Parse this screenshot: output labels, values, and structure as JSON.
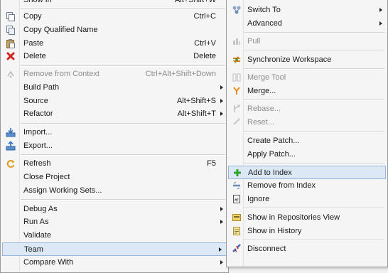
{
  "left_menu": {
    "items": [
      {
        "label": "Show In",
        "shortcut": "Alt+Shift+W",
        "icon": "show-in-icon"
      },
      {
        "label": "Copy",
        "shortcut": "Ctrl+C",
        "icon": "copy-icon"
      },
      {
        "label": "Copy Qualified Name",
        "shortcut": "",
        "icon": "copy-qualified-name-icon"
      },
      {
        "label": "Paste",
        "shortcut": "Ctrl+V",
        "icon": "paste-icon"
      },
      {
        "label": "Delete",
        "shortcut": "Delete",
        "icon": "delete-icon"
      },
      {
        "label": "Remove from Context",
        "shortcut": "Ctrl+Alt+Shift+Down",
        "icon": "remove-from-context-icon"
      },
      {
        "label": "Build Path",
        "shortcut": "",
        "icon": ""
      },
      {
        "label": "Source",
        "shortcut": "Alt+Shift+S",
        "icon": ""
      },
      {
        "label": "Refactor",
        "shortcut": "Alt+Shift+T",
        "icon": ""
      },
      {
        "label": "Import...",
        "shortcut": "",
        "icon": "import-icon"
      },
      {
        "label": "Export...",
        "shortcut": "",
        "icon": "export-icon"
      },
      {
        "label": "Refresh",
        "shortcut": "F5",
        "icon": "refresh-icon"
      },
      {
        "label": "Close Project",
        "shortcut": "",
        "icon": ""
      },
      {
        "label": "Assign Working Sets...",
        "shortcut": "",
        "icon": ""
      },
      {
        "label": "Debug As",
        "shortcut": "",
        "icon": ""
      },
      {
        "label": "Run As",
        "shortcut": "",
        "icon": ""
      },
      {
        "label": "Validate",
        "shortcut": "",
        "icon": ""
      },
      {
        "label": "Team",
        "shortcut": "",
        "icon": ""
      },
      {
        "label": "Compare With",
        "shortcut": "",
        "icon": ""
      }
    ]
  },
  "right_menu": {
    "items": [
      {
        "label": "Switch To",
        "icon": "switch-to-icon"
      },
      {
        "label": "Advanced",
        "icon": ""
      },
      {
        "label": "Pull",
        "icon": "pull-icon"
      },
      {
        "label": "Synchronize Workspace",
        "icon": "synchronize-workspace-icon"
      },
      {
        "label": "Merge Tool",
        "icon": "merge-tool-icon"
      },
      {
        "label": "Merge...",
        "icon": "merge-icon"
      },
      {
        "label": "Rebase...",
        "icon": "rebase-icon"
      },
      {
        "label": "Reset...",
        "icon": "reset-icon"
      },
      {
        "label": "Create Patch...",
        "icon": ""
      },
      {
        "label": "Apply Patch...",
        "icon": ""
      },
      {
        "label": "Add to Index",
        "icon": "add-to-index-icon"
      },
      {
        "label": "Remove from Index",
        "icon": "remove-from-index-icon"
      },
      {
        "label": "Ignore",
        "icon": "ignore-icon"
      },
      {
        "label": "Show in Repositories View",
        "icon": "show-in-repositories-view-icon"
      },
      {
        "label": "Show in History",
        "icon": "show-in-history-icon"
      },
      {
        "label": "Disconnect",
        "icon": "disconnect-icon"
      }
    ]
  }
}
